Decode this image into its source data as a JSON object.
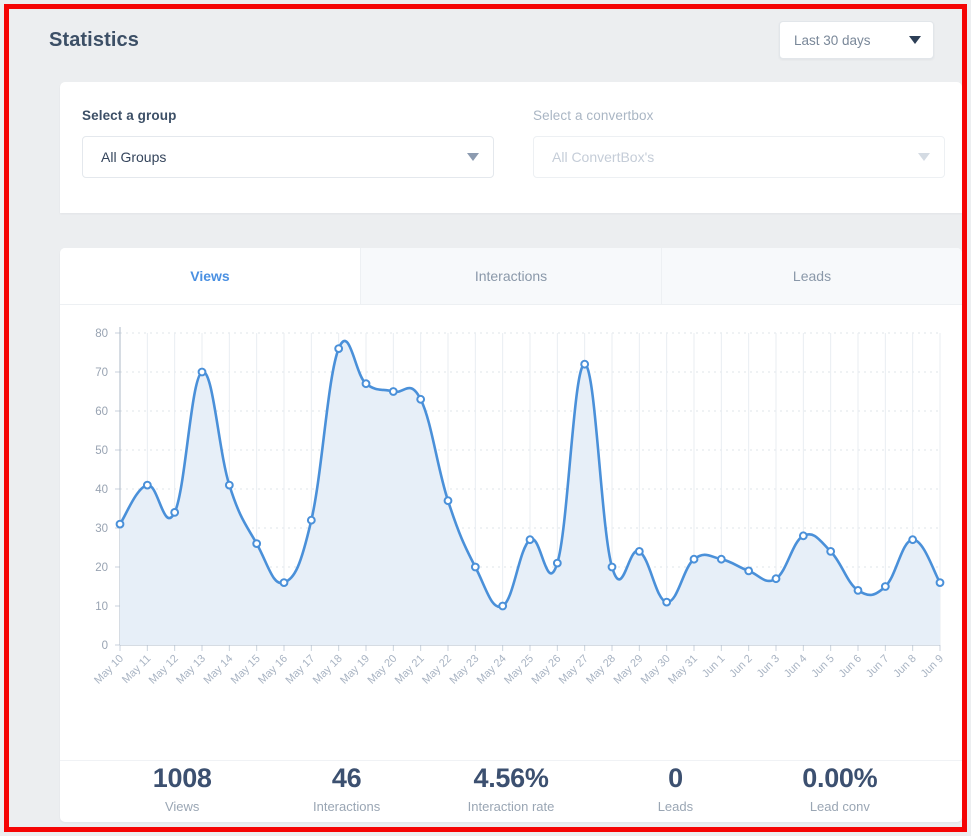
{
  "header": {
    "title": "Statistics",
    "date_range": {
      "value": "Last 30 days",
      "icon": "chevron-down-icon"
    }
  },
  "filters": {
    "group": {
      "label": "Select a group",
      "value": "All Groups",
      "icon": "chevron-down-icon"
    },
    "convertbox": {
      "label": "Select a convertbox",
      "placeholder": "All ConvertBox's",
      "disabled": true,
      "icon": "chevron-down-icon"
    }
  },
  "tabs": [
    {
      "label": "Views",
      "active": true
    },
    {
      "label": "Interactions",
      "active": false
    },
    {
      "label": "Leads",
      "active": false
    }
  ],
  "summary": [
    {
      "value": "1008",
      "caption": "Views"
    },
    {
      "value": "46",
      "caption": "Interactions"
    },
    {
      "value": "4.56%",
      "caption": "Interaction rate"
    },
    {
      "value": "0",
      "caption": "Leads"
    },
    {
      "value": "0.00%",
      "caption": "Lead conv"
    }
  ],
  "colors": {
    "line": "#4a90d9",
    "area": "#e7eff8",
    "accent": "#4a90e2",
    "title": "#3c4f66",
    "frame": "#f50505",
    "page_bg": "#eceef0"
  },
  "chart_data": {
    "type": "area",
    "title": "Views",
    "xlabel": "",
    "ylabel": "",
    "ylim": [
      0,
      80
    ],
    "yticks": [
      0,
      10,
      20,
      30,
      40,
      50,
      60,
      70,
      80
    ],
    "grid": true,
    "legend": "none",
    "categories": [
      "May 10",
      "May 11",
      "May 12",
      "May 13",
      "May 14",
      "May 15",
      "May 16",
      "May 17",
      "May 18",
      "May 19",
      "May 20",
      "May 21",
      "May 22",
      "May 23",
      "May 24",
      "May 25",
      "May 26",
      "May 27",
      "May 28",
      "May 29",
      "May 30",
      "May 31",
      "Jun 1",
      "Jun 2",
      "Jun 3",
      "Jun 4",
      "Jun 5",
      "Jun 6",
      "Jun 7",
      "Jun 8",
      "Jun 9"
    ],
    "values": [
      31,
      41,
      34,
      70,
      41,
      26,
      16,
      32,
      76,
      67,
      65,
      63,
      37,
      20,
      10,
      27,
      21,
      72,
      20,
      24,
      11,
      22,
      22,
      19,
      17,
      28,
      24,
      14,
      15,
      27,
      16
    ],
    "series": [
      {
        "name": "Views",
        "values": [
          31,
          41,
          34,
          70,
          41,
          26,
          16,
          32,
          76,
          67,
          65,
          63,
          37,
          20,
          10,
          27,
          21,
          72,
          20,
          24,
          11,
          22,
          22,
          19,
          17,
          28,
          24,
          14,
          15,
          27,
          16
        ]
      }
    ]
  }
}
